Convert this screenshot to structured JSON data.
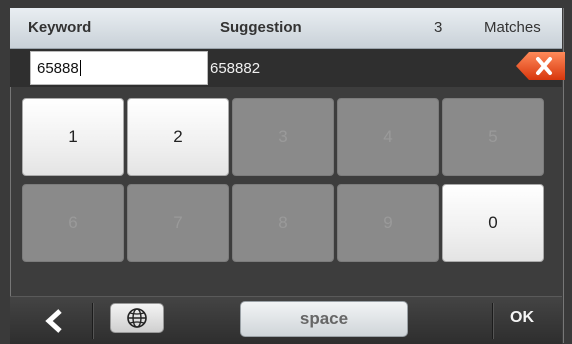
{
  "header": {
    "keyword_label": "Keyword",
    "suggestion_label": "Suggestion",
    "match_count": "3",
    "matches_label": "Matches"
  },
  "input": {
    "keyword_value": "65888",
    "suggestion_value": "658882"
  },
  "keypad": {
    "keys": [
      {
        "label": "1",
        "enabled": true
      },
      {
        "label": "2",
        "enabled": true
      },
      {
        "label": "3",
        "enabled": false
      },
      {
        "label": "4",
        "enabled": false
      },
      {
        "label": "5",
        "enabled": false
      },
      {
        "label": "6",
        "enabled": false
      },
      {
        "label": "7",
        "enabled": false
      },
      {
        "label": "8",
        "enabled": false
      },
      {
        "label": "9",
        "enabled": false
      },
      {
        "label": "0",
        "enabled": true
      }
    ]
  },
  "bottombar": {
    "back_icon": "chevron-left-icon",
    "language_icon": "globe-icon",
    "space_label": "space",
    "ok_label": "OK"
  },
  "colors": {
    "clear_button": "#e8501e",
    "header_bg": "#dfe5ea",
    "panel_bg": "#3d3d3d"
  }
}
